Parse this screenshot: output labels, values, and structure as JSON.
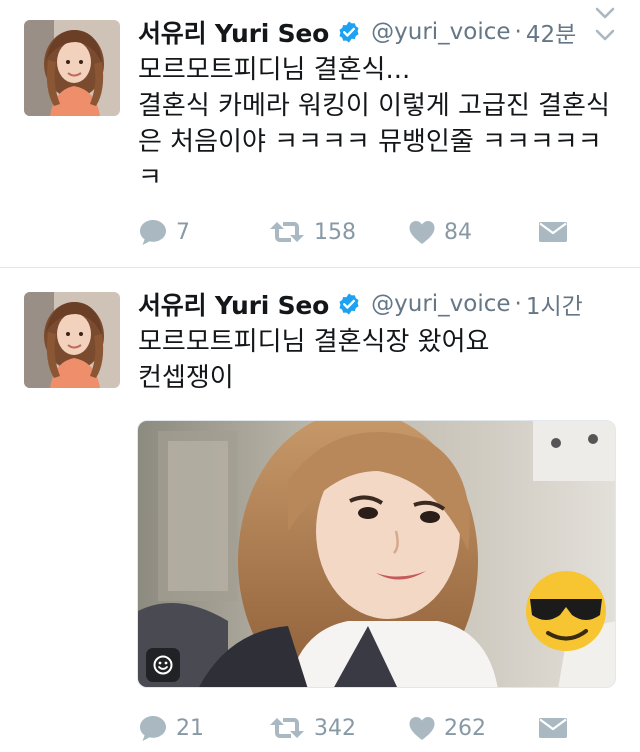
{
  "tweets": [
    {
      "display_name": "서유리 Yuri Seo",
      "handle": "@yuri_voice",
      "separator": "·",
      "time": "42분",
      "text_lines": [
        "모르모트피디님 결혼식...",
        "결혼식 카메라 워킹이 이렇게 고급진 결혼식",
        "은 처음이야 ㅋㅋㅋㅋ 뮤뱅인줄 ㅋㅋㅋㅋㅋ",
        "ㅋ"
      ],
      "replies": "7",
      "retweets": "158",
      "likes": "84"
    },
    {
      "display_name": "서유리 Yuri Seo",
      "handle": "@yuri_voice",
      "separator": "·",
      "time": "1시간",
      "text_lines": [
        "모르모트피디님 결혼식장 왔어요",
        "컨셉쟁이"
      ],
      "replies": "21",
      "retweets": "342",
      "likes": "262"
    }
  ],
  "icons": {
    "verified": "verified-badge-icon",
    "caret": "chevron-down-icon",
    "reply": "reply-bubble-icon",
    "retweet": "retweet-icon",
    "like": "heart-icon",
    "dm": "envelope-icon",
    "sticker": "smiley-icon"
  },
  "colors": {
    "verified_blue": "#1da1f2",
    "muted": "#8899a6",
    "handle_gray": "#657786"
  }
}
